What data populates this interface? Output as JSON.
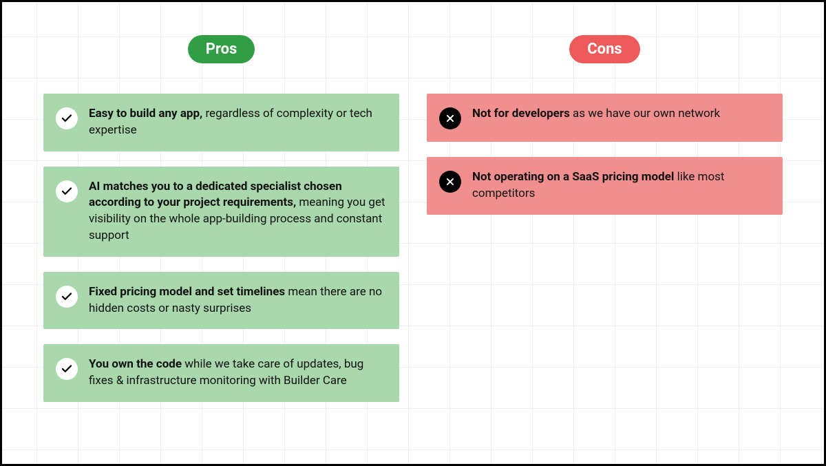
{
  "pros": {
    "label": "Pros",
    "items": [
      {
        "bold": "Easy to build any app,",
        "rest": " regardless of complexity or tech expertise"
      },
      {
        "bold": "AI matches you to a dedicated specialist chosen according to your project requirements,",
        "rest": " meaning you get visibility on the whole app-building process and constant support"
      },
      {
        "bold": "Fixed pricing model and set timelines",
        "rest": " mean there are no hidden costs or nasty surprises"
      },
      {
        "bold": "You own the code",
        "rest": " while we take care of updates, bug fixes & infrastructure monitoring with Builder Care"
      }
    ]
  },
  "cons": {
    "label": "Cons",
    "items": [
      {
        "bold": "Not for developers",
        "rest": " as we have our own network"
      },
      {
        "bold": "Not operating on a SaaS pricing model",
        "rest": " like most competitors"
      }
    ]
  }
}
